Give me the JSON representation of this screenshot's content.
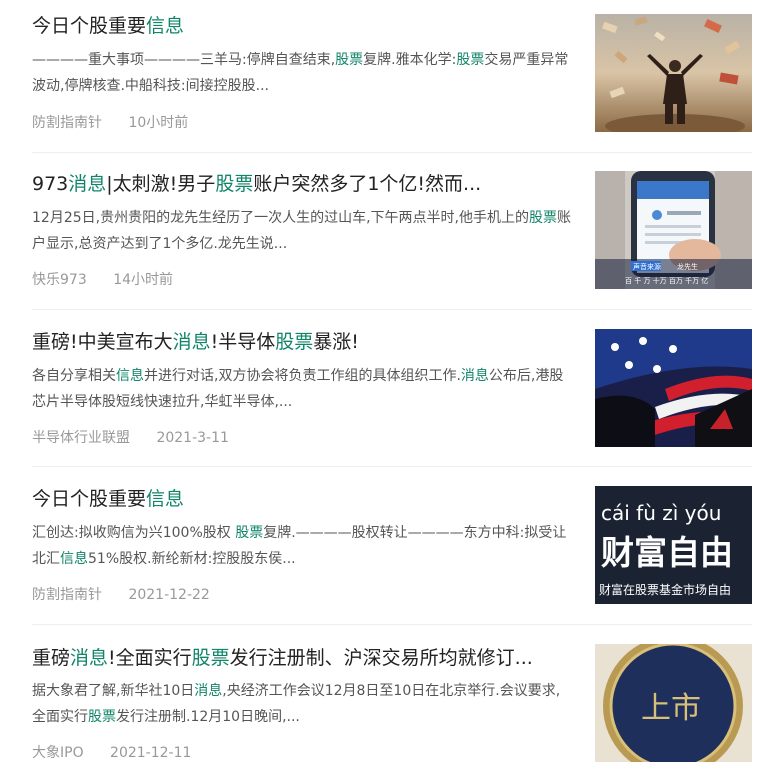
{
  "feed": [
    {
      "title": [
        {
          "t": "今日个股重要"
        },
        {
          "t": "信息",
          "hl": true
        }
      ],
      "summary": [
        {
          "t": "————重大事项————三羊马:停牌自查结束,"
        },
        {
          "t": "股票",
          "hl": true
        },
        {
          "t": "复牌.雅本化学:"
        },
        {
          "t": "股票",
          "hl": true
        },
        {
          "t": "交易严重异常波动,停牌核查.中船科技:间接控股股..."
        }
      ],
      "source": "防割指南针",
      "time": "10小时前",
      "image": "money-rain-image"
    },
    {
      "title": [
        {
          "t": "973"
        },
        {
          "t": "消息",
          "hl": true
        },
        {
          "t": "|太刺激!男子"
        },
        {
          "t": "股票",
          "hl": true
        },
        {
          "t": "账户突然多了1个亿!然而..."
        }
      ],
      "summary": [
        {
          "t": "12月25日,贵州贵阳的龙先生经历了一次人生的过山车,下午两点半时,他手机上的"
        },
        {
          "t": "股票",
          "hl": true
        },
        {
          "t": "账户显示,总资产达到了1个多亿.龙先生说..."
        }
      ],
      "source": "快乐973",
      "time": "14小时前",
      "image": "phone-account-image",
      "thumb_text": {
        "tag": "声音来源",
        "name": "龙先生",
        "caption": "百 千 万 十万 百万 千万 亿"
      }
    },
    {
      "title": [
        {
          "t": "重磅!中美宣布大"
        },
        {
          "t": "消息",
          "hl": true
        },
        {
          "t": "!半导体"
        },
        {
          "t": "股票",
          "hl": true
        },
        {
          "t": "暴涨!"
        }
      ],
      "summary": [
        {
          "t": "各自分享相关"
        },
        {
          "t": "信息",
          "hl": true
        },
        {
          "t": "并进行对话,双方协会将负责工作组的具体组织工作."
        },
        {
          "t": "消息",
          "hl": true
        },
        {
          "t": "公布后,港股芯片半导体股短线快速拉升,华虹半导体,..."
        }
      ],
      "source": "半导体行业联盟",
      "time": "2021-3-11",
      "image": "us-flag-image"
    },
    {
      "title": [
        {
          "t": "今日个股重要"
        },
        {
          "t": "信息",
          "hl": true
        }
      ],
      "summary": [
        {
          "t": "汇创达:拟收购信为兴100%股权 "
        },
        {
          "t": "股票",
          "hl": true
        },
        {
          "t": "复牌.————股权转让————东方中科:拟受让北汇"
        },
        {
          "t": "信息",
          "hl": true
        },
        {
          "t": "51%股权.新纶新材:控股股东侯..."
        }
      ],
      "source": "防割指南针",
      "time": "2021-12-22",
      "image": "wealth-freedom-image",
      "thumb_text": {
        "pinyin": "cái fù zì yóu",
        "big": "财富自由",
        "small": "财富在股票基金市场自由"
      }
    },
    {
      "title": [
        {
          "t": "重磅"
        },
        {
          "t": "消息",
          "hl": true
        },
        {
          "t": "!全面实行"
        },
        {
          "t": "股票",
          "hl": true
        },
        {
          "t": "发行注册制、沪深交易所均就修订..."
        }
      ],
      "summary": [
        {
          "t": "据大象君了解,新华社10日"
        },
        {
          "t": "消息",
          "hl": true
        },
        {
          "t": ",央经济工作会议12月8日至10日在北京举行.会议要求,全面实行"
        },
        {
          "t": "股票",
          "hl": true
        },
        {
          "t": "发行注册制.12月10日晚间,..."
        }
      ],
      "source": "大象IPO",
      "time": "2021-12-11",
      "image": "listing-coin-image",
      "thumb_text": {
        "big": "上市"
      }
    }
  ],
  "colors": {
    "highlight": "#11856a",
    "title": "#222222",
    "summary": "#555555",
    "meta": "#999999"
  }
}
